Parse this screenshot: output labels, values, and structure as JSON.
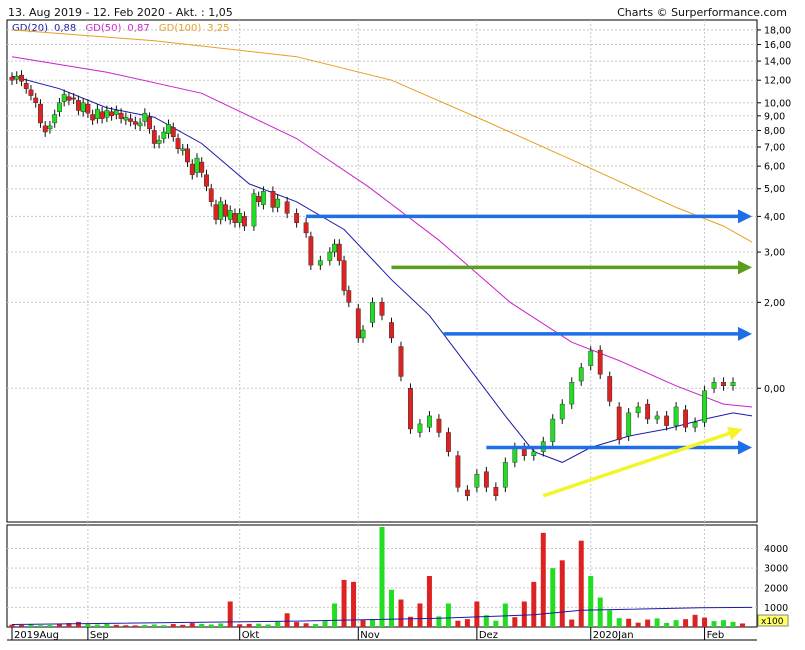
{
  "header": {
    "date_range": "13. Aug 2019 - 12. Feb 2020 - Akt. : 1,05",
    "credit": "Charts © Surperformance.com"
  },
  "legend": [
    {
      "label": "GD(20)",
      "value": "0,88",
      "color": "#1a1aa8"
    },
    {
      "label": "GD(50)",
      "value": "0,87",
      "color": "#cc22cc"
    },
    {
      "label": "GD(100)",
      "value": "3,25",
      "color": "#e8a020"
    }
  ],
  "colors": {
    "up": "#22dd22",
    "down": "#dd2222",
    "wick": "#111111",
    "blue_arrow": "#1e6ee8",
    "green_arrow": "#5a9e1e",
    "yellow_arrow": "#f4f42a",
    "grid": "#c8c8c8"
  },
  "chart_data": {
    "type": "candlestick",
    "y_axis_ticks": [
      "18,00",
      "16,00",
      "14,00",
      "12,00",
      "10,00",
      "9,00",
      "8,00",
      "7,00",
      "6,00",
      "5,00",
      "4,00",
      "3,00",
      "2,00",
      "0,00"
    ],
    "y_axis_tick_values": [
      18,
      16,
      14,
      12,
      10,
      9,
      8,
      7,
      6,
      5,
      4,
      3,
      2,
      1
    ],
    "y_scale": "log",
    "volume_ticks": [
      "4000",
      "3000",
      "2000",
      "1000"
    ],
    "volume_tick_values": [
      4000,
      3000,
      2000,
      1000
    ],
    "volume_unit": "x100",
    "x_labels": [
      "2019Aug",
      "Sep",
      "Okt",
      "Nov",
      "Dez",
      "2020Jan",
      "Feb"
    ],
    "x_label_positions": [
      0,
      16,
      48,
      73,
      98,
      122,
      146
    ],
    "n_bars": 157,
    "candles": [
      {
        "o": 12.3,
        "c": 12.0
      },
      {
        "o": 12.1,
        "c": 12.4
      },
      {
        "o": 12.5,
        "c": 11.9
      },
      {
        "o": 11.7,
        "c": 11.2
      },
      {
        "o": 11.1,
        "c": 10.6
      },
      {
        "o": 10.4,
        "c": 10.0
      },
      {
        "o": 9.9,
        "c": 8.5
      },
      {
        "o": 8.3,
        "c": 7.9
      },
      {
        "o": 8.1,
        "c": 8.3
      },
      {
        "o": 8.5,
        "c": 9.1
      },
      {
        "o": 9.3,
        "c": 10.0
      },
      {
        "o": 10.1,
        "c": 10.7
      },
      {
        "o": 10.5,
        "c": 10.2
      },
      {
        "o": 10.4,
        "c": 10.3
      },
      {
        "o": 10.2,
        "c": 9.4
      },
      {
        "o": 9.3,
        "c": 10.0
      },
      {
        "o": 9.9,
        "c": 9.2
      },
      {
        "o": 9.1,
        "c": 8.7
      },
      {
        "o": 8.8,
        "c": 9.5
      },
      {
        "o": 9.3,
        "c": 8.8
      },
      {
        "o": 8.9,
        "c": 9.4
      },
      {
        "o": 9.3,
        "c": 9.0
      },
      {
        "o": 9.1,
        "c": 9.4
      },
      {
        "o": 9.2,
        "c": 8.8
      },
      {
        "o": 8.7,
        "c": 8.9
      },
      {
        "o": 8.8,
        "c": 8.6
      },
      {
        "o": 8.6,
        "c": 8.4
      },
      {
        "o": 8.3,
        "c": 8.5
      },
      {
        "o": 8.6,
        "c": 9.2
      },
      {
        "o": 8.9,
        "c": 8.1
      },
      {
        "o": 8.0,
        "c": 7.2
      },
      {
        "o": 7.2,
        "c": 7.4
      },
      {
        "o": 7.5,
        "c": 7.9
      },
      {
        "o": 7.8,
        "c": 8.4
      },
      {
        "o": 8.2,
        "c": 7.6
      },
      {
        "o": 7.5,
        "c": 6.9
      },
      {
        "o": 6.8,
        "c": 6.9
      },
      {
        "o": 6.9,
        "c": 6.2
      },
      {
        "o": 6.1,
        "c": 5.6
      },
      {
        "o": 5.7,
        "c": 6.4
      },
      {
        "o": 6.2,
        "c": 5.7
      },
      {
        "o": 5.6,
        "c": 5.1
      },
      {
        "o": 5.0,
        "c": 4.5
      },
      {
        "o": 4.4,
        "c": 3.9
      },
      {
        "o": 3.9,
        "c": 4.5
      },
      {
        "o": 4.4,
        "c": 4.0
      },
      {
        "o": 3.9,
        "c": 4.2
      },
      {
        "o": 4.1,
        "c": 3.8
      },
      {
        "o": 3.8,
        "c": 4.1
      },
      {
        "o": 4.0,
        "c": 3.7
      },
      {
        "o": 3.7,
        "c": 4.8
      },
      {
        "o": 4.7,
        "c": 4.5
      },
      {
        "o": 4.4,
        "c": 4.9
      },
      {
        "o": 4.9,
        "c": 4.3
      },
      {
        "o": 4.3,
        "c": 4.6
      },
      {
        "o": 4.5,
        "c": 4.1
      },
      {
        "o": 4.1,
        "c": 3.8
      },
      {
        "o": 3.8,
        "c": 3.5
      },
      {
        "o": 3.4,
        "c": 2.7
      },
      {
        "o": 2.7,
        "c": 2.8
      },
      {
        "o": 2.8,
        "c": 3.0
      },
      {
        "o": 3.0,
        "c": 3.2
      },
      {
        "o": 3.2,
        "c": 2.8
      },
      {
        "o": 2.8,
        "c": 2.2
      },
      {
        "o": 2.2,
        "c": 2.0
      },
      {
        "o": 1.9,
        "c": 1.5
      },
      {
        "o": 1.5,
        "c": 1.6
      },
      {
        "o": 1.7,
        "c": 2.0
      },
      {
        "o": 2.0,
        "c": 1.8
      },
      {
        "o": 1.7,
        "c": 1.5
      },
      {
        "o": 1.4,
        "c": 1.1
      },
      {
        "o": 1.0,
        "c": 0.72
      },
      {
        "o": 0.7,
        "c": 0.75
      },
      {
        "o": 0.73,
        "c": 0.8
      },
      {
        "o": 0.78,
        "c": 0.7
      },
      {
        "o": 0.7,
        "c": 0.6
      },
      {
        "o": 0.58,
        "c": 0.45
      },
      {
        "o": 0.44,
        "c": 0.42
      },
      {
        "o": 0.45,
        "c": 0.5
      },
      {
        "o": 0.51,
        "c": 0.45
      },
      {
        "o": 0.45,
        "c": 0.42
      },
      {
        "o": 0.45,
        "c": 0.55
      },
      {
        "o": 0.55,
        "c": 0.62
      },
      {
        "o": 0.62,
        "c": 0.58
      },
      {
        "o": 0.58,
        "c": 0.6
      },
      {
        "o": 0.6,
        "c": 0.65
      },
      {
        "o": 0.65,
        "c": 0.78
      },
      {
        "o": 0.78,
        "c": 0.88
      },
      {
        "o": 0.88,
        "c": 1.05
      },
      {
        "o": 1.06,
        "c": 1.18
      },
      {
        "o": 1.2,
        "c": 1.35
      },
      {
        "o": 1.36,
        "c": 1.12
      },
      {
        "o": 1.1,
        "c": 0.9
      },
      {
        "o": 0.86,
        "c": 0.66
      },
      {
        "o": 0.68,
        "c": 0.82
      },
      {
        "o": 0.82,
        "c": 0.86
      },
      {
        "o": 0.88,
        "c": 0.78
      },
      {
        "o": 0.78,
        "c": 0.8
      },
      {
        "o": 0.8,
        "c": 0.74
      },
      {
        "o": 0.74,
        "c": 0.86
      },
      {
        "o": 0.84,
        "c": 0.73
      },
      {
        "o": 0.73,
        "c": 0.76
      },
      {
        "o": 0.76,
        "c": 0.98
      },
      {
        "o": 1.0,
        "c": 1.05
      },
      {
        "o": 1.05,
        "c": 1.02
      },
      {
        "o": 1.02,
        "c": 1.05
      }
    ],
    "candle_positions": [
      0,
      1,
      2,
      3,
      4,
      5,
      6,
      7,
      8,
      9,
      10,
      11,
      12,
      13,
      14,
      15,
      16,
      17,
      18,
      19,
      20,
      21,
      22,
      23,
      24,
      25,
      26,
      27,
      28,
      29,
      30,
      31,
      32,
      33,
      34,
      35,
      36,
      37,
      38,
      39,
      40,
      41,
      42,
      43,
      44,
      45,
      46,
      47,
      48,
      49,
      51,
      52,
      53,
      55,
      56,
      58,
      60,
      62,
      63,
      65,
      67,
      68,
      69,
      70,
      71,
      73,
      74,
      76,
      78,
      80,
      82,
      84,
      86,
      88,
      90,
      92,
      94,
      96,
      98,
      100,
      102,
      104,
      106,
      108,
      110,
      112,
      114,
      116,
      118,
      120,
      122,
      124,
      126,
      128,
      130,
      132,
      134,
      136,
      138,
      140,
      142,
      144,
      146,
      148,
      150,
      152,
      154
    ],
    "ma20": [
      [
        0,
        12.4
      ],
      [
        10,
        11.2
      ],
      [
        20,
        9.6
      ],
      [
        30,
        8.9
      ],
      [
        40,
        7.2
      ],
      [
        50,
        5.2
      ],
      [
        60,
        4.5
      ],
      [
        70,
        3.6
      ],
      [
        80,
        2.4
      ],
      [
        88,
        1.8
      ],
      [
        96,
        1.2
      ],
      [
        104,
        0.8
      ],
      [
        110,
        0.6
      ],
      [
        116,
        0.55
      ],
      [
        122,
        0.62
      ],
      [
        130,
        0.68
      ],
      [
        138,
        0.72
      ],
      [
        146,
        0.78
      ],
      [
        152,
        0.82
      ],
      [
        156,
        0.8
      ]
    ],
    "ma50": [
      [
        0,
        14.5
      ],
      [
        20,
        12.8
      ],
      [
        40,
        10.8
      ],
      [
        60,
        7.5
      ],
      [
        75,
        5.1
      ],
      [
        90,
        3.3
      ],
      [
        105,
        2.0
      ],
      [
        118,
        1.45
      ],
      [
        128,
        1.25
      ],
      [
        140,
        1.02
      ],
      [
        150,
        0.88
      ],
      [
        156,
        0.86
      ]
    ],
    "ma100": [
      [
        0,
        18.0
      ],
      [
        30,
        16.5
      ],
      [
        60,
        14.5
      ],
      [
        80,
        12.0
      ],
      [
        100,
        8.6
      ],
      [
        120,
        6.1
      ],
      [
        140,
        4.3
      ],
      [
        150,
        3.7
      ],
      [
        156,
        3.25
      ]
    ],
    "volume": [
      [
        0,
        120
      ],
      [
        2,
        100
      ],
      [
        4,
        140
      ],
      [
        6,
        90
      ],
      [
        8,
        100
      ],
      [
        10,
        180
      ],
      [
        12,
        200
      ],
      [
        14,
        260
      ],
      [
        16,
        150
      ],
      [
        18,
        130
      ],
      [
        20,
        160
      ],
      [
        22,
        110
      ],
      [
        24,
        90
      ],
      [
        26,
        80
      ],
      [
        28,
        100
      ],
      [
        30,
        130
      ],
      [
        32,
        90
      ],
      [
        34,
        150
      ],
      [
        36,
        110
      ],
      [
        38,
        200
      ],
      [
        40,
        160
      ],
      [
        42,
        130
      ],
      [
        44,
        180
      ],
      [
        46,
        1300
      ],
      [
        48,
        140
      ],
      [
        50,
        160
      ],
      [
        52,
        170
      ],
      [
        54,
        130
      ],
      [
        56,
        260
      ],
      [
        58,
        700
      ],
      [
        60,
        250
      ],
      [
        62,
        190
      ],
      [
        64,
        150
      ],
      [
        66,
        300
      ],
      [
        68,
        1200
      ],
      [
        70,
        2400
      ],
      [
        72,
        2300
      ],
      [
        74,
        350
      ],
      [
        76,
        400
      ],
      [
        78,
        5100
      ],
      [
        80,
        1900
      ],
      [
        82,
        1400
      ],
      [
        84,
        520
      ],
      [
        86,
        1200
      ],
      [
        88,
        2600
      ],
      [
        90,
        540
      ],
      [
        92,
        1200
      ],
      [
        94,
        320
      ],
      [
        96,
        400
      ],
      [
        98,
        1300
      ],
      [
        100,
        600
      ],
      [
        102,
        320
      ],
      [
        104,
        1200
      ],
      [
        106,
        500
      ],
      [
        108,
        1300
      ],
      [
        110,
        2300
      ],
      [
        112,
        4800
      ],
      [
        114,
        3000
      ],
      [
        116,
        3400
      ],
      [
        118,
        380
      ],
      [
        120,
        4400
      ],
      [
        122,
        2600
      ],
      [
        124,
        1500
      ],
      [
        126,
        850
      ],
      [
        128,
        450
      ],
      [
        130,
        420
      ],
      [
        132,
        220
      ],
      [
        134,
        380
      ],
      [
        136,
        440
      ],
      [
        138,
        210
      ],
      [
        140,
        350
      ],
      [
        142,
        400
      ],
      [
        144,
        620
      ],
      [
        146,
        480
      ],
      [
        148,
        300
      ],
      [
        150,
        350
      ],
      [
        152,
        260
      ],
      [
        154,
        180
      ]
    ],
    "volume_ma": [
      [
        0,
        130
      ],
      [
        60,
        300
      ],
      [
        90,
        450
      ],
      [
        110,
        620
      ],
      [
        120,
        850
      ],
      [
        130,
        900
      ],
      [
        145,
        980
      ],
      [
        156,
        1000
      ]
    ],
    "annotations": [
      {
        "type": "arrow",
        "color": "blue",
        "from": [
          62,
          4.0
        ],
        "to": [
          156,
          4.0
        ]
      },
      {
        "type": "arrow",
        "color": "green",
        "from": [
          80,
          2.65
        ],
        "to": [
          156,
          2.65
        ]
      },
      {
        "type": "arrow",
        "color": "blue",
        "from": [
          91,
          1.55
        ],
        "to": [
          156,
          1.55
        ]
      },
      {
        "type": "arrow",
        "color": "blue",
        "from": [
          100,
          0.62
        ],
        "to": [
          156,
          0.62
        ]
      },
      {
        "type": "arrow",
        "color": "yellow",
        "from": [
          112,
          0.42
        ],
        "to": [
          154,
          0.72
        ]
      }
    ]
  }
}
